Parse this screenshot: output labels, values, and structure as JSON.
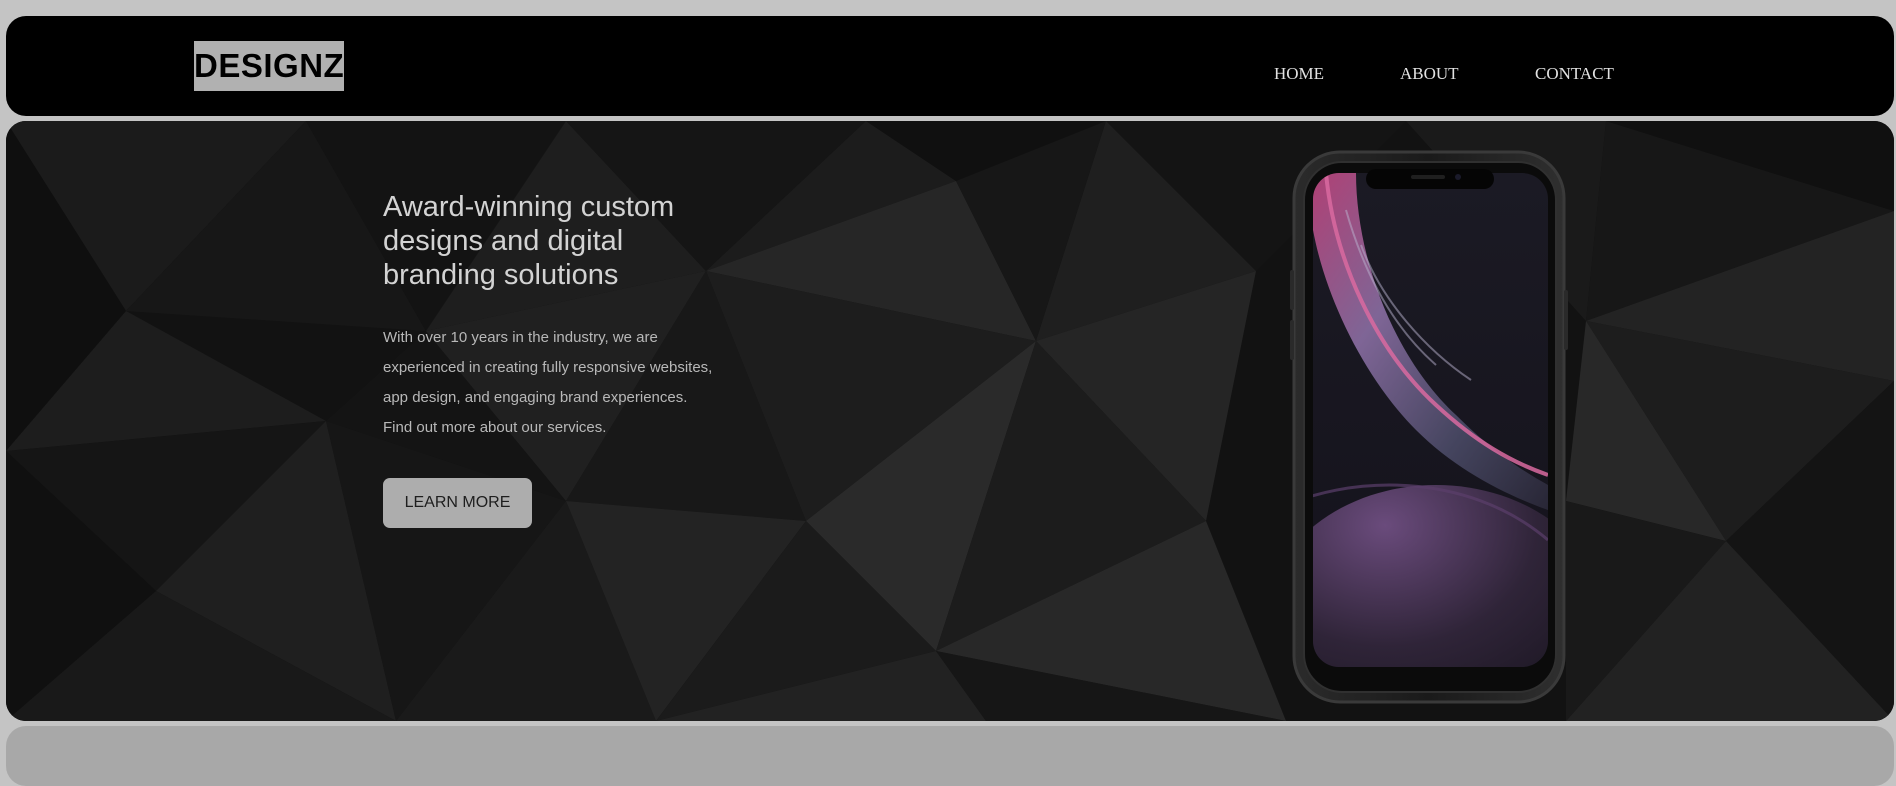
{
  "brand": {
    "logo_text": "DESIGNZ"
  },
  "nav": {
    "items": [
      "HOME",
      "ABOUT",
      "CONTACT"
    ]
  },
  "hero": {
    "title": "Award-winning custom designs and digital branding solutions",
    "body": "With over 10 years in the industry, we are experienced in creating fully responsive websites, app design, and engaging brand experiences. Find out more about our services.",
    "cta_label": "LEARN MORE"
  },
  "colors": {
    "page_background": "#c4c4c4",
    "header_background": "#000000",
    "logo_background": "#b1b1b1",
    "hero_background": "#121212",
    "button_background": "#adadad",
    "next_section_background": "#a8a8a8"
  }
}
